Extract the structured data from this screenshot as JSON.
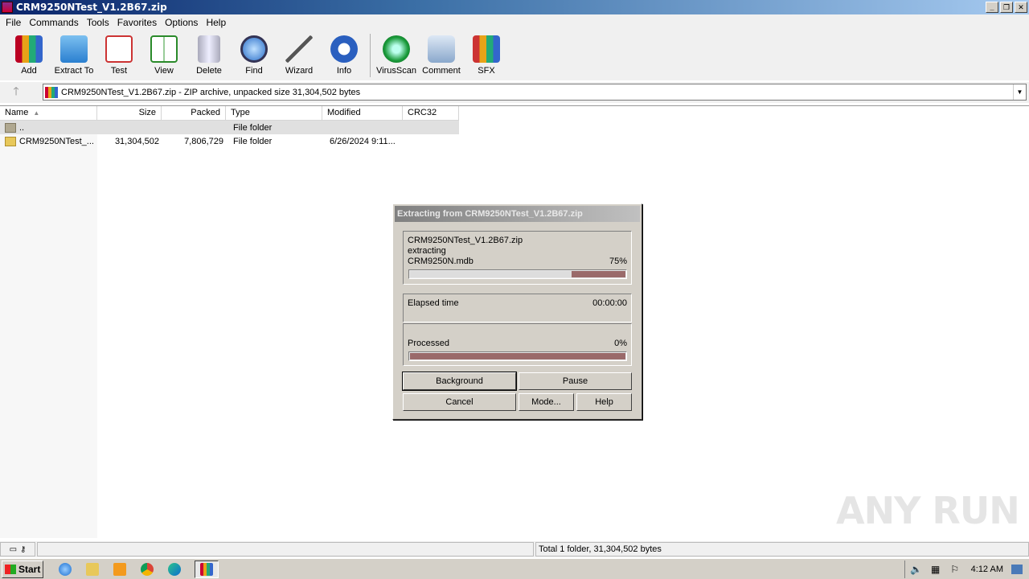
{
  "window": {
    "title": "CRM9250NTest_V1.2B67.zip"
  },
  "menu": [
    "File",
    "Commands",
    "Tools",
    "Favorites",
    "Options",
    "Help"
  ],
  "toolbar": {
    "buttons": [
      {
        "label": "Add",
        "icon": "archive-add-icon"
      },
      {
        "label": "Extract To",
        "icon": "folder-extract-icon"
      },
      {
        "label": "Test",
        "icon": "clipboard-check-icon"
      },
      {
        "label": "View",
        "icon": "book-view-icon"
      },
      {
        "label": "Delete",
        "icon": "trash-icon"
      },
      {
        "label": "Find",
        "icon": "magnifier-icon"
      },
      {
        "label": "Wizard",
        "icon": "wand-icon"
      },
      {
        "label": "Info",
        "icon": "info-icon"
      },
      {
        "label": "VirusScan",
        "icon": "bug-icon"
      },
      {
        "label": "Comment",
        "icon": "comment-icon"
      },
      {
        "label": "SFX",
        "icon": "sfx-box-icon"
      }
    ]
  },
  "address": {
    "text": "CRM9250NTest_V1.2B67.zip - ZIP archive, unpacked size 31,304,502 bytes"
  },
  "columns": [
    "Name",
    "Size",
    "Packed",
    "Type",
    "Modified",
    "CRC32"
  ],
  "rows": [
    {
      "name": "..",
      "size": "",
      "packed": "",
      "type": "File folder",
      "modified": "",
      "crc": ""
    },
    {
      "name": "CRM9250NTest_...",
      "size": "31,304,502",
      "packed": "7,806,729",
      "type": "File folder",
      "modified": "6/26/2024 9:11...",
      "crc": ""
    }
  ],
  "status": {
    "total": "Total 1 folder, 31,304,502 bytes"
  },
  "dialog": {
    "title": "Extracting from CRM9250NTest_V1.2B67.zip",
    "archive": "CRM9250NTest_V1.2B67.zip",
    "action": "extracting",
    "file": "CRM9250N.mdb",
    "file_percent": "75%",
    "file_progress": 0.75,
    "elapsed_label": "Elapsed time",
    "elapsed_value": "00:00:00",
    "processed_label": "Processed",
    "processed_percent": "0%",
    "processed_progress": 0.0,
    "buttons": {
      "background": "Background",
      "pause": "Pause",
      "cancel": "Cancel",
      "mode": "Mode...",
      "help": "Help"
    }
  },
  "taskbar": {
    "start": "Start",
    "clock": "4:12 AM"
  },
  "watermark": "ANY RUN"
}
